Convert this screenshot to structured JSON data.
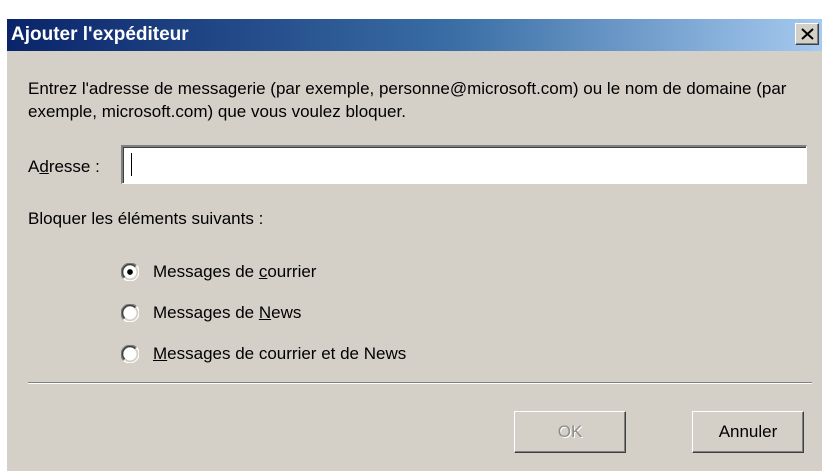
{
  "window": {
    "title": "Ajouter l'expéditeur",
    "close_icon": "close-icon"
  },
  "instruction": "Entrez l'adresse de messagerie (par exemple, personne@microsoft.com) ou le nom de domaine (par exemple, microsoft.com) que vous voulez bloquer.",
  "address": {
    "label_prefix": "A",
    "label_mnemonic": "d",
    "label_rest": "resse :",
    "value": ""
  },
  "block": {
    "label": "Bloquer les éléments suivants :",
    "options": [
      {
        "pre": "Messages de ",
        "mnemonic": "c",
        "post": "ourrier",
        "checked": true
      },
      {
        "pre": "Messages de ",
        "mnemonic": "N",
        "post": "ews",
        "checked": false
      },
      {
        "pre": "",
        "mnemonic": "M",
        "post": "essages de courrier et de News",
        "checked": false
      }
    ]
  },
  "buttons": {
    "ok": "OK",
    "ok_enabled": false,
    "cancel": "Annuler"
  }
}
